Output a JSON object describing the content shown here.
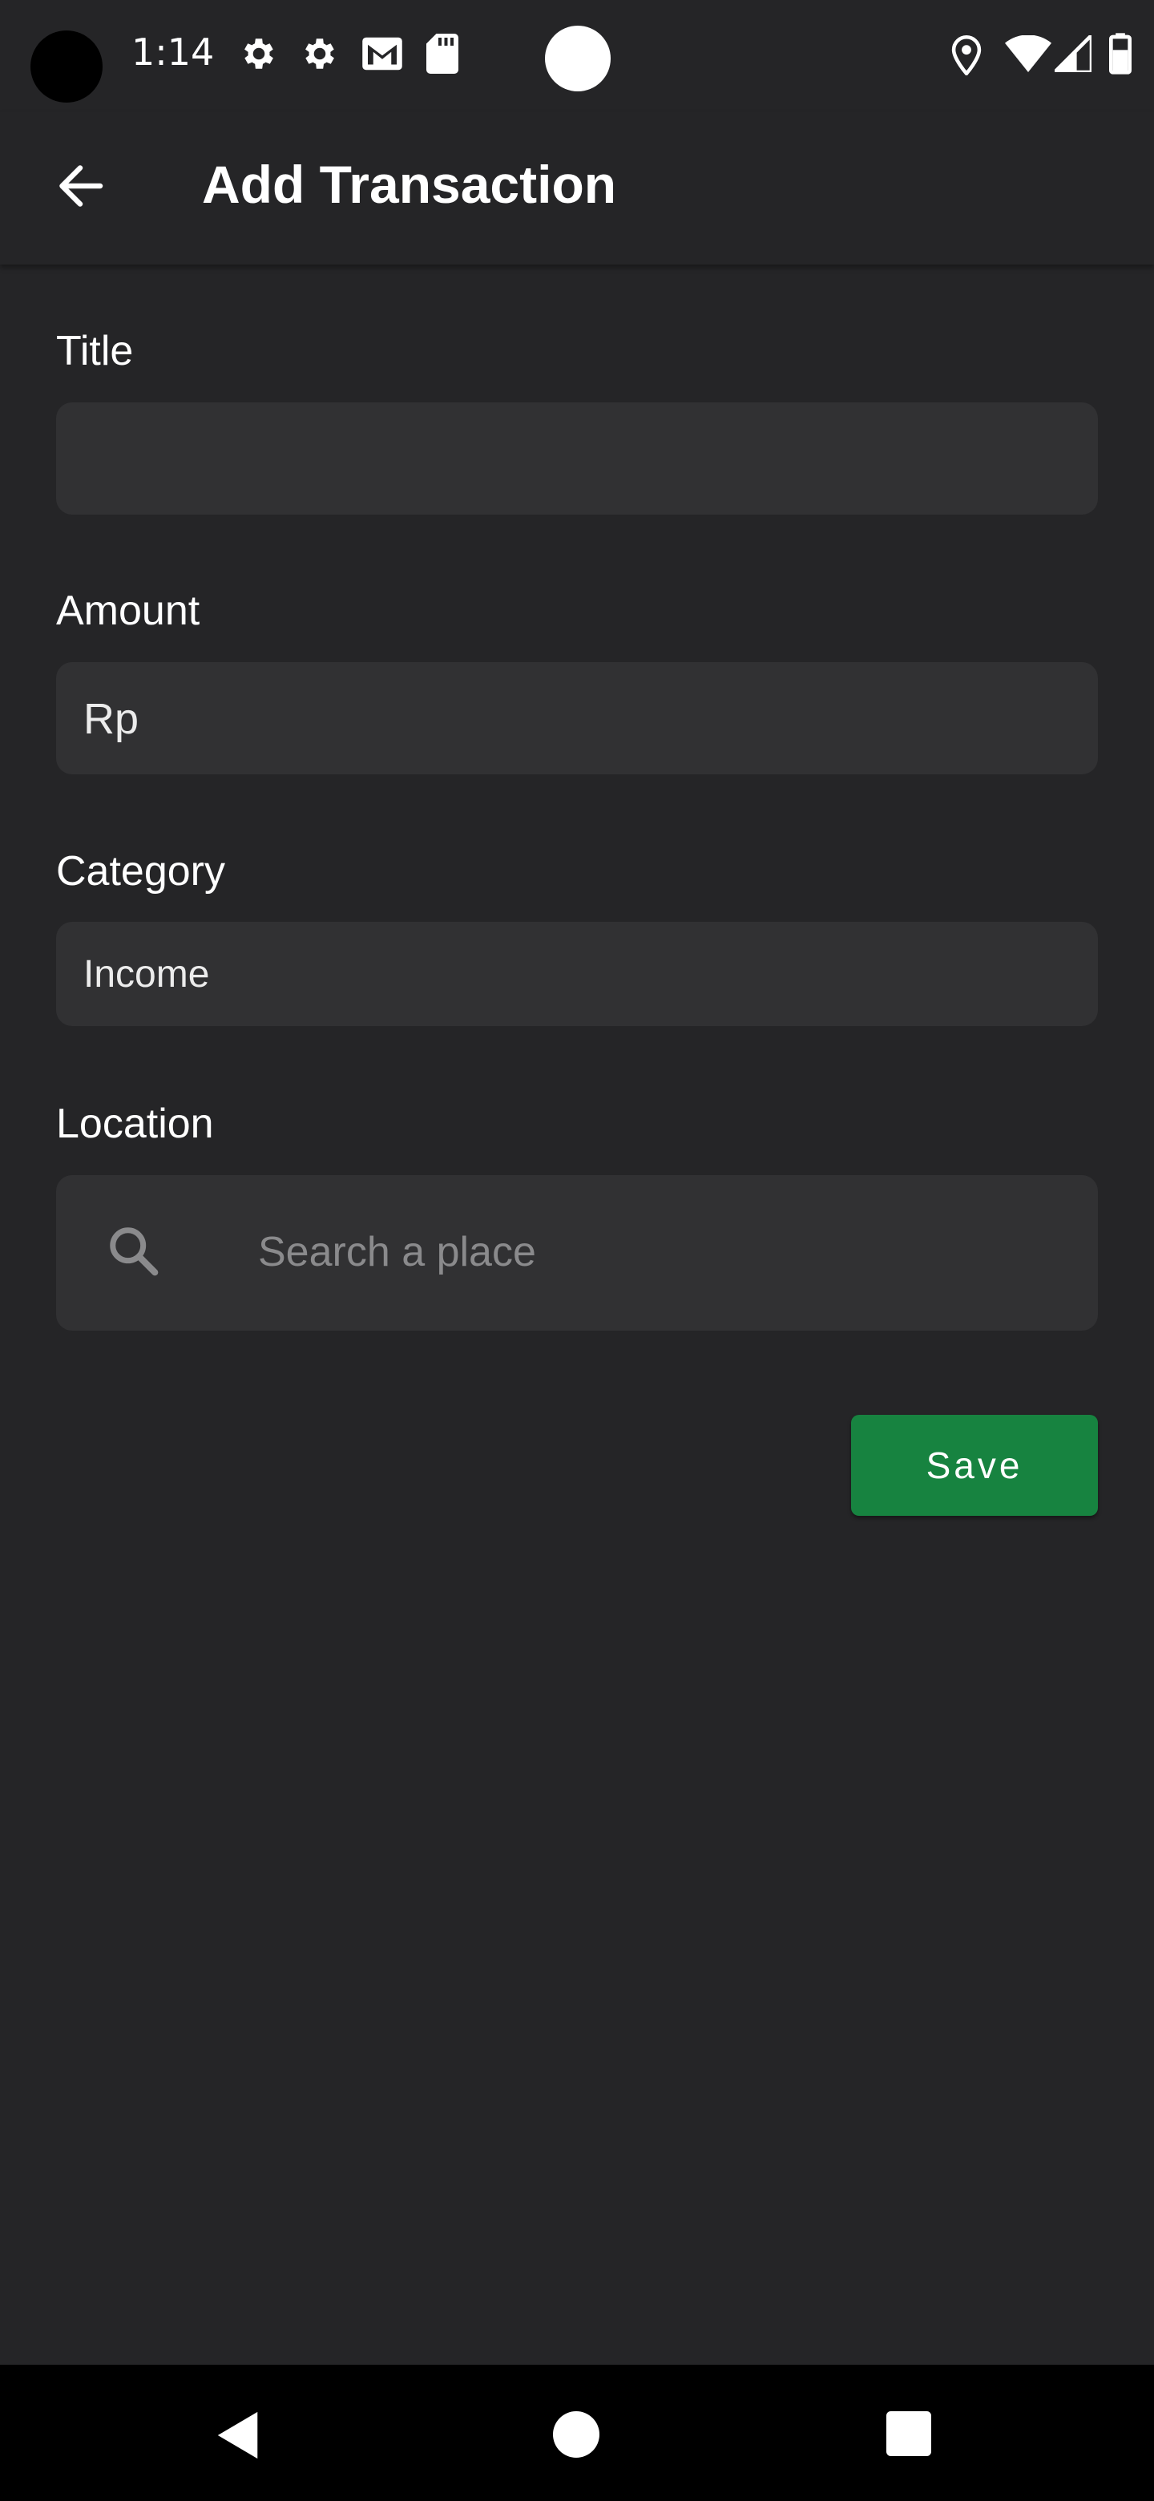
{
  "status_bar": {
    "time": "1:14",
    "icons": [
      "gear-icon",
      "gear-icon",
      "gmail-icon",
      "sd-card-icon",
      "location-icon",
      "wifi-icon",
      "signal-icon",
      "battery-icon"
    ]
  },
  "app_bar": {
    "title": "Add Transaction",
    "back_icon": "arrow-left-icon"
  },
  "form": {
    "title": {
      "label": "Title",
      "value": ""
    },
    "amount": {
      "label": "Amount",
      "value": "Rp"
    },
    "category": {
      "label": "Category",
      "value": "Income"
    },
    "location": {
      "label": "Location",
      "placeholder": "Search a place",
      "icon": "search-icon"
    },
    "save_label": "Save"
  },
  "nav_bar": {
    "icons": [
      "back-triangle-icon",
      "home-circle-icon",
      "recents-square-icon"
    ]
  },
  "colors": {
    "background": "#252527",
    "field": "#313133",
    "accent": "#178340"
  }
}
